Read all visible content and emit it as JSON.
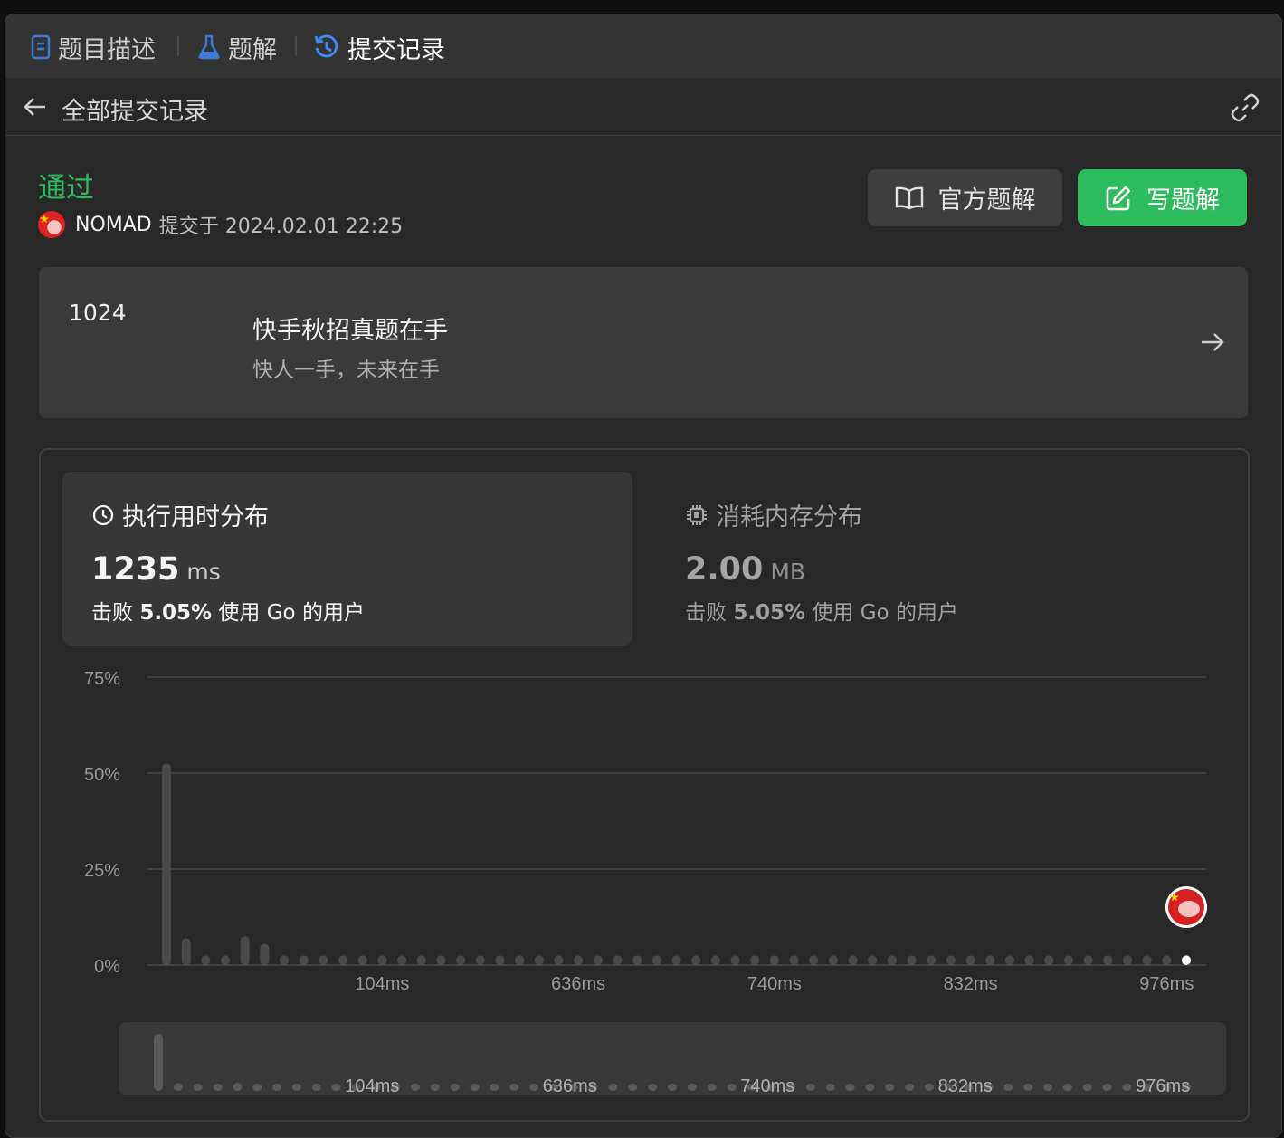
{
  "tabs": [
    {
      "label": "题目描述",
      "icon": "document-icon",
      "active": false
    },
    {
      "label": "题解",
      "icon": "flask-icon",
      "active": false
    },
    {
      "label": "提交记录",
      "icon": "history-icon",
      "active": true
    }
  ],
  "subheader": {
    "title": "全部提交记录",
    "back_icon": "arrow-left-icon",
    "share_icon": "link-icon"
  },
  "submission": {
    "status": "通过",
    "user": "NOMAD",
    "meta": "提交于 2024.02.01 22:25"
  },
  "actions": {
    "official_label": "官方题解",
    "write_label": "写题解"
  },
  "promo": {
    "number": "1024",
    "title": "快手秋招真题在手",
    "subtitle": "快人一手，未来在手"
  },
  "runtime": {
    "heading": "执行用时分布",
    "value": "1235",
    "unit": "ms",
    "beats_prefix": "击败",
    "beats_pct": "5.05%",
    "beats_suffix": "使用 Go 的用户"
  },
  "memory": {
    "heading": "消耗内存分布",
    "value": "2.00",
    "unit": "MB",
    "beats_prefix": "击败",
    "beats_pct": "5.05%",
    "beats_suffix": "使用 Go 的用户"
  },
  "colors": {
    "accent_green": "#2cbb5d",
    "bar": "#4a4a4a",
    "bar_highlight": "#ffffff"
  },
  "chart_data": {
    "type": "bar",
    "yticks": [
      "75%",
      "50%",
      "25%",
      "0%"
    ],
    "ylim": [
      0,
      75
    ],
    "xtick_labels": [
      "104ms",
      "636ms",
      "740ms",
      "832ms",
      "976ms"
    ],
    "xtick_positions": [
      11,
      21,
      31,
      41,
      51
    ],
    "values": [
      52.5,
      7,
      2.5,
      2.5,
      7.5,
      5.5,
      2.5,
      2.5,
      2.5,
      2.5,
      2.5,
      2.5,
      2.5,
      2.5,
      2.5,
      2.5,
      2.5,
      2.5,
      2.5,
      2.5,
      2.5,
      2.5,
      2.5,
      2.5,
      2.5,
      2.5,
      2.5,
      2.5,
      2.5,
      2.5,
      2.5,
      2.5,
      2.5,
      2.5,
      2.5,
      2.5,
      2.5,
      2.5,
      2.5,
      2.5,
      2.5,
      2.5,
      2.5,
      2.5,
      2.5,
      2.5,
      2.5,
      2.5,
      2.5,
      2.5,
      2.5,
      2.5,
      2.5
    ],
    "highlight_index": 52,
    "grid": true,
    "navigator_xtick_labels": [
      "104ms",
      "636ms",
      "740ms",
      "832ms",
      "976ms"
    ]
  }
}
